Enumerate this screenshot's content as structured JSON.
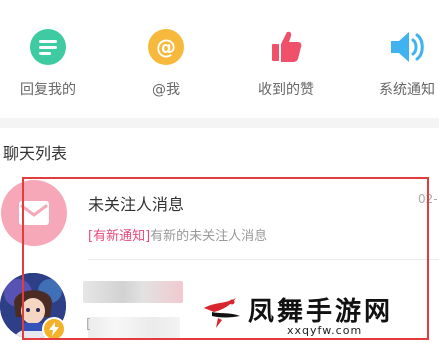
{
  "quick_entries": [
    {
      "label": "回复我的",
      "icon": "comment-bubble-icon",
      "color": "#3fcba1"
    },
    {
      "label": "@我",
      "icon": "at-sign-icon",
      "color": "#f6b93b"
    },
    {
      "label": "收到的赞",
      "icon": "thumbs-up-icon",
      "color": "#f0516a"
    },
    {
      "label": "系统通知",
      "icon": "speaker-icon",
      "color": "#3fb2ef"
    }
  ],
  "chat_list": {
    "title": "聊天列表",
    "items": [
      {
        "name": "未关注人消息",
        "preview_tag": "[有新通知]",
        "preview_text": "有新的未关注人消息",
        "time": "02-",
        "avatar_icon": "envelope-icon"
      },
      {
        "name": "",
        "preview_bracket": "[",
        "avatar_icon": "game-character-avatar"
      }
    ]
  },
  "watermark": {
    "name": "凤舞手游网",
    "url": "xxqyfw.com"
  },
  "colors": {
    "accent_pink": "#e74a7b",
    "highlight_red": "#e23c3c",
    "avatar_pink": "#f6a8b8"
  }
}
